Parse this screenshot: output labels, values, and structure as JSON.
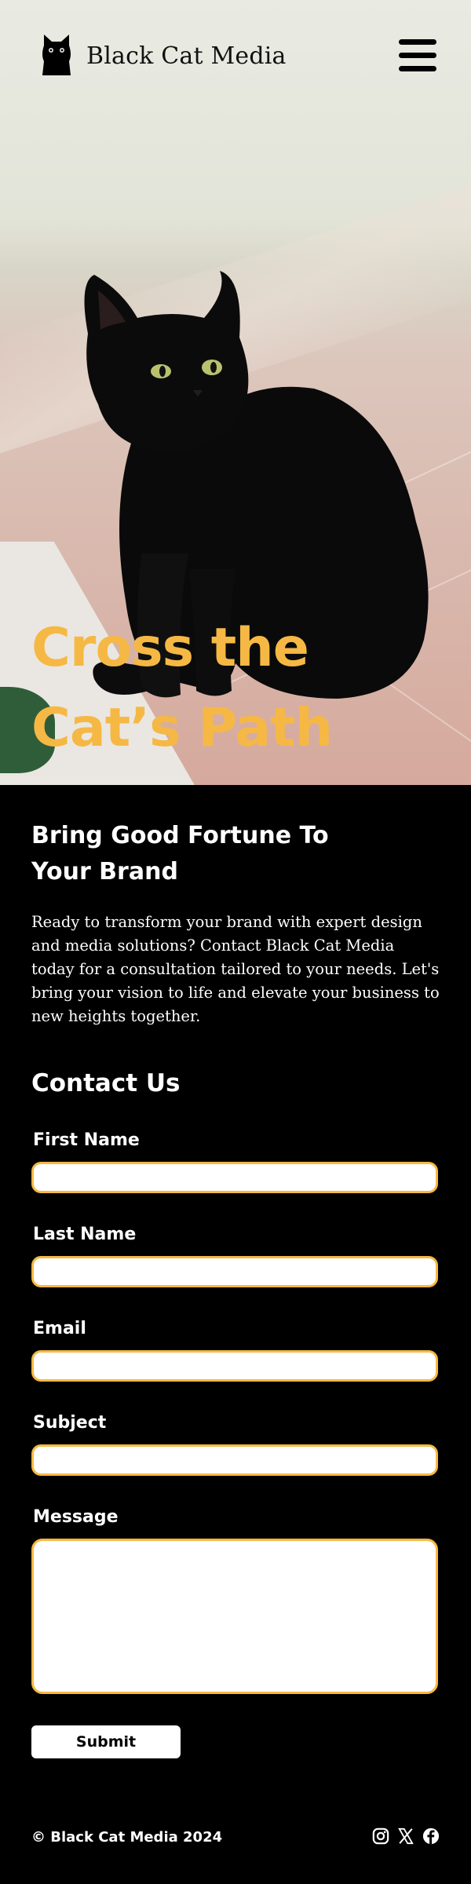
{
  "header": {
    "brand_name": "Black Cat Media",
    "logo_icon": "black-cat-icon",
    "menu_icon": "hamburger-menu-icon"
  },
  "hero": {
    "title_line1": "Cross the",
    "title_line2": "Cat’s Path",
    "image_subject": "black cat sitting on tiled floor",
    "title_color": "#f6b844"
  },
  "intro": {
    "heading_line1": "Bring Good Fortune To",
    "heading_line2": "Your Brand",
    "body": "Ready to transform your brand with expert design and media solutions? Contact Black Cat Media today for a consultation tailored to your needs. Let's bring your vision to life and elevate your business to new heights together."
  },
  "contact": {
    "heading": "Contact Us",
    "fields": [
      {
        "label": "First Name",
        "value": ""
      },
      {
        "label": "Last Name",
        "value": ""
      },
      {
        "label": "Email",
        "value": ""
      },
      {
        "label": "Subject",
        "value": ""
      },
      {
        "label": "Message",
        "value": ""
      }
    ],
    "submit_label": "Submit",
    "accent_color": "#f6b844"
  },
  "footer": {
    "copyright": "© Black Cat Media 2024",
    "social_icons": [
      "instagram-icon",
      "x-icon",
      "facebook-icon"
    ]
  }
}
